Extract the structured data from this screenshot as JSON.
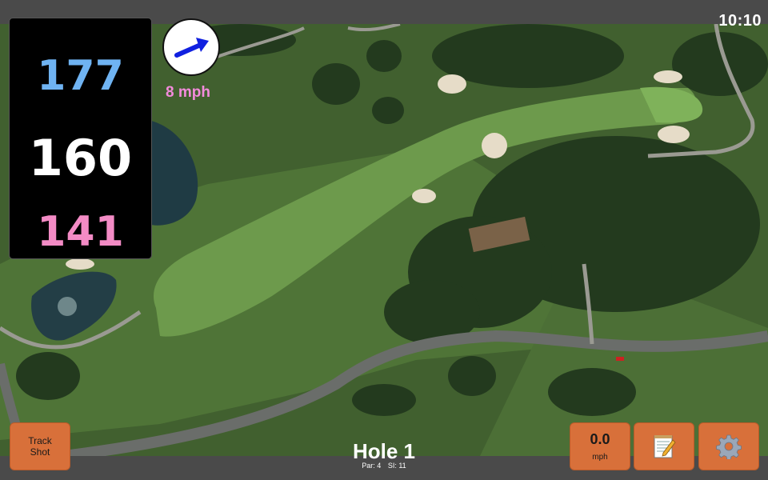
{
  "clock": {
    "time": "10:10"
  },
  "distances": {
    "back": "177",
    "middle": "160",
    "front": "141"
  },
  "wind": {
    "speed_label": "8 mph",
    "arrow_color": "#1020e0"
  },
  "buttons": {
    "track_shot": "Track\nShot",
    "speed_value": "0.0",
    "speed_unit": "mph",
    "notes_icon": "notepad-icon",
    "settings_icon": "gear-icon"
  },
  "hole": {
    "title": "Hole 1",
    "par": "Par: 4",
    "stroke_index": "SI: 11"
  },
  "colors": {
    "back": "#6fb3f2",
    "middle": "#ffffff",
    "front": "#f38bc5",
    "wind_text": "#f38bdc",
    "button": "#d8703a"
  }
}
